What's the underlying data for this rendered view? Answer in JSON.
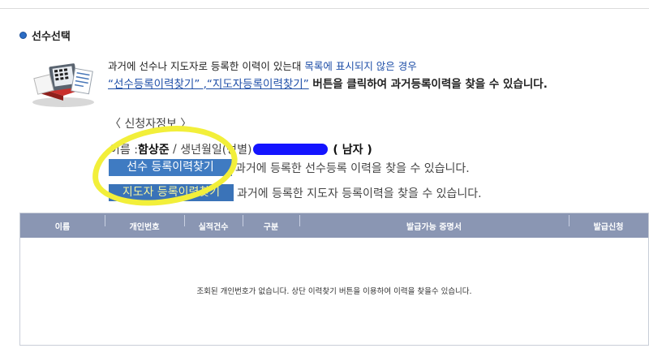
{
  "section": {
    "title": "선수선택"
  },
  "intro": {
    "line1_prefix": "과거에 선수나 지도자로 등록한 이력이 있는대 ",
    "line1_highlight": "목록에 표시되지 않은 경우",
    "line2_link": "“선수등록이력찾기” ,“지도자등록이력찾기”",
    "line2_suffix": " 버튼을 클릭하여 과거등록이력을 찾을 수 있습니다."
  },
  "applicant": {
    "heading": "〈 신청자정보 〉",
    "name_label": "이름 : ",
    "name_value": "함상준",
    "separator": " / ",
    "birth_label": "생년월일(성별)",
    "gender": "( 남자 )"
  },
  "actions": {
    "player_button": "선수 등록이력찾기",
    "player_desc": "과거에 등록한 선수등록 이력을 찾을 수 있습니다.",
    "coach_button": "지도자 등록이력찾기",
    "coach_desc": "과거에 등록한 지도자 등록이력을 찾을 수 있습니다."
  },
  "table": {
    "columns": [
      "이름",
      "개인번호",
      "실적건수",
      "구분",
      "발급가능 증명서",
      "발급신청"
    ],
    "empty_message": "조회된 개인번호가 없습니다. 상단 이력찾기 버튼을 이용하여 이력을 찾을수 있습니다."
  },
  "colors": {
    "accent_blue": "#1f4fa8",
    "button_blue": "#3f7bc2",
    "table_header": "#8a96b3",
    "highlight_yellow": "#f2ef3a",
    "redaction": "#1414ff"
  }
}
